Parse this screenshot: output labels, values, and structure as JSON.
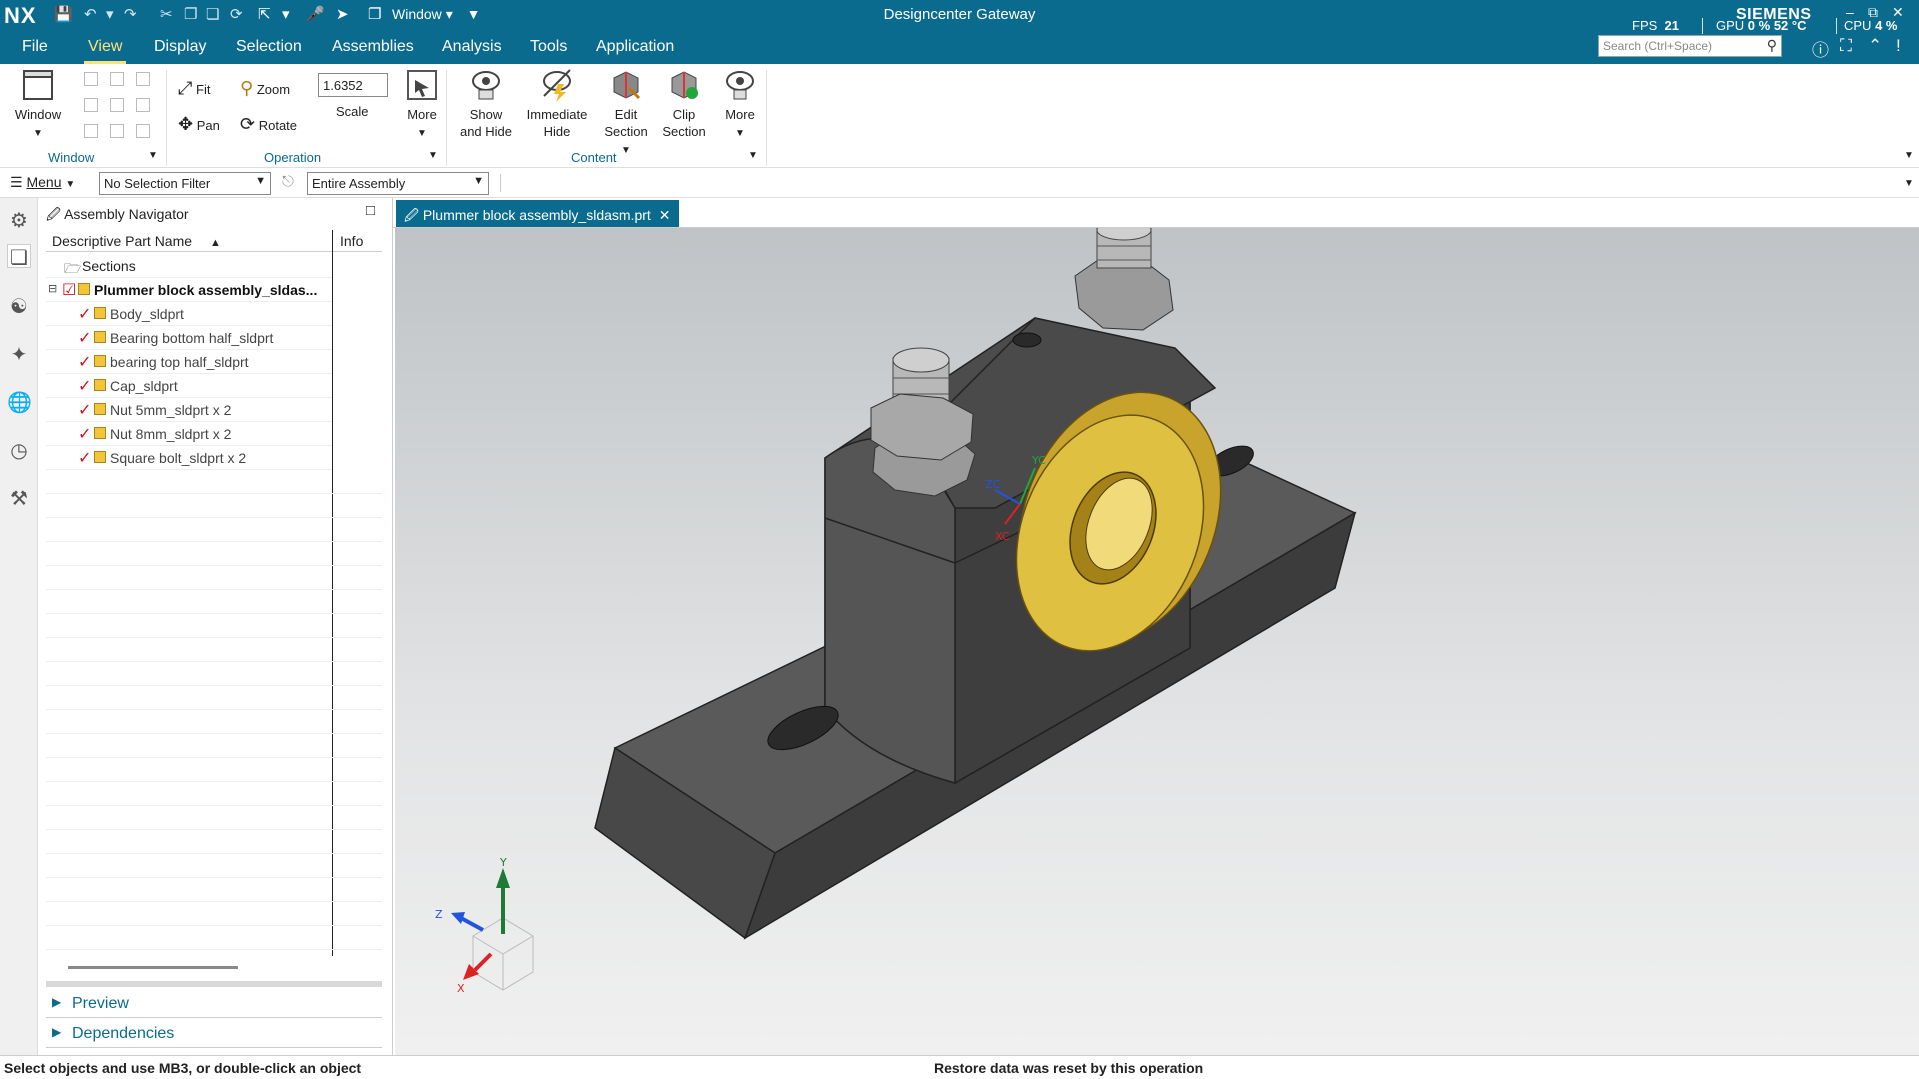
{
  "titlebar": {
    "logo": "NX",
    "window_menu": "Window",
    "app_title": "Designcenter Gateway",
    "brand": "SIEMENS",
    "fps_label": "FPS",
    "fps_value": "21",
    "gpu_label": "GPU",
    "gpu_value": "0 %",
    "gpu_temp": "52 °C",
    "cpu_label": "CPU",
    "cpu_value": "4 %"
  },
  "menu_tabs": [
    "File",
    "View",
    "Display",
    "Selection",
    "Assemblies",
    "Analysis",
    "Tools",
    "Application"
  ],
  "active_tab": "View",
  "search": {
    "placeholder": "Search (Ctrl+Space)"
  },
  "ribbon": {
    "window_group": {
      "button": "Window",
      "label": "Window"
    },
    "operation_group": {
      "fit": "Fit",
      "zoom": "Zoom",
      "pan": "Pan",
      "rotate": "Rotate",
      "scale_value": "1.6352",
      "scale_label": "Scale",
      "more": "More",
      "label": "Operation"
    },
    "content_group": {
      "show_hide_1": "Show",
      "show_hide_2": "and Hide",
      "immediate_hide_1": "Immediate",
      "immediate_hide_2": "Hide",
      "edit_section_1": "Edit",
      "edit_section_2": "Section",
      "clip_section_1": "Clip",
      "clip_section_2": "Section",
      "more": "More",
      "label": "Content"
    }
  },
  "selection_bar": {
    "menu": "Menu",
    "filter": "No Selection Filter",
    "scope": "Entire Assembly"
  },
  "navigator": {
    "title": "Assembly Navigator",
    "col_name": "Descriptive Part Name",
    "col_info": "Info",
    "sections": "Sections",
    "root": "Plummer block assembly_sldas...",
    "parts": [
      "Body_sldprt",
      "Bearing bottom half_sldprt",
      "bearing top half_sldprt",
      "Cap_sldprt",
      "Nut 5mm_sldprt x 2",
      "Nut 8mm_sldprt x 2",
      "Square bolt_sldprt x 2"
    ],
    "preview": "Preview",
    "dependencies": "Dependencies"
  },
  "document_tab": {
    "title": "Plummer block assembly_sldasm.prt"
  },
  "triad": {
    "x": "X",
    "y": "Y",
    "z": "Z"
  },
  "wcs": {
    "xc": "XC",
    "yc": "YC",
    "zc": "ZC"
  },
  "status": {
    "left": "Select objects and use MB3, or double-click an object",
    "middle": "Restore data was reset by this operation"
  },
  "colors": {
    "titlebar": "#0a6b8f",
    "accent_tab": "#ffe27a",
    "housing": "#4a4a4a",
    "bearing": "#e2c13a"
  }
}
